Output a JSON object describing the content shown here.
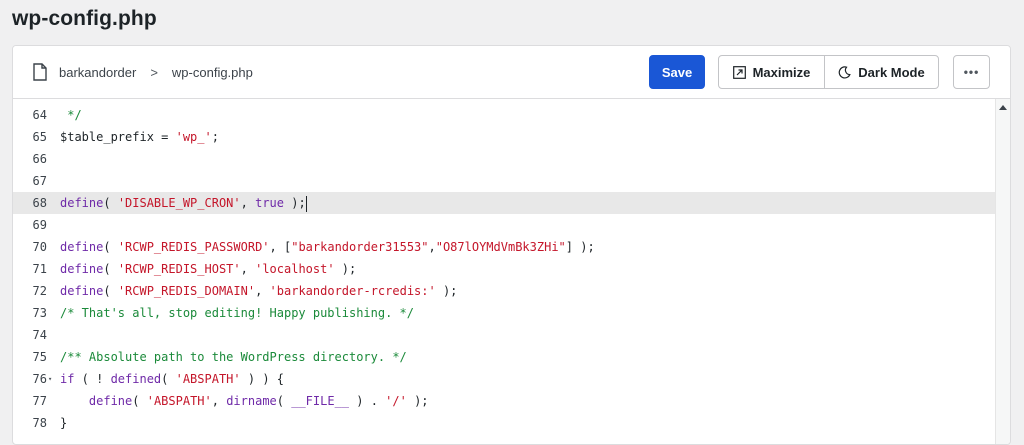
{
  "page": {
    "title": "wp-config.php"
  },
  "breadcrumb": {
    "root": "barkandorder",
    "separator": ">",
    "file": "wp-config.php"
  },
  "toolbar": {
    "save_label": "Save",
    "maximize_label": "Maximize",
    "dark_mode_label": "Dark Mode",
    "more_label": "•••"
  },
  "colors": {
    "accent": "#1a57d6",
    "comment": "#1b8a3a",
    "function": "#6f2aa8",
    "string": "#c4162a"
  },
  "editor": {
    "active_line": 68,
    "lines": [
      {
        "n": "64",
        "tokens": [
          {
            "t": "comment",
            "v": " */"
          }
        ]
      },
      {
        "n": "65",
        "tokens": [
          {
            "t": "var",
            "v": "$table_prefix"
          },
          {
            "t": "op",
            "v": " = "
          },
          {
            "t": "str",
            "v": "'wp_'"
          },
          {
            "t": "op",
            "v": ";"
          }
        ]
      },
      {
        "n": "66",
        "tokens": []
      },
      {
        "n": "67",
        "tokens": []
      },
      {
        "n": "68",
        "tokens": [
          {
            "t": "fn",
            "v": "define"
          },
          {
            "t": "op",
            "v": "( "
          },
          {
            "t": "str",
            "v": "'DISABLE_WP_CRON'"
          },
          {
            "t": "op",
            "v": ", "
          },
          {
            "t": "kw",
            "v": "true"
          },
          {
            "t": "op",
            "v": " );"
          }
        ]
      },
      {
        "n": "69",
        "tokens": []
      },
      {
        "n": "70",
        "tokens": [
          {
            "t": "fn",
            "v": "define"
          },
          {
            "t": "op",
            "v": "( "
          },
          {
            "t": "str",
            "v": "'RCWP_REDIS_PASSWORD'"
          },
          {
            "t": "op",
            "v": ", ["
          },
          {
            "t": "str",
            "v": "\"barkandorder31553\""
          },
          {
            "t": "op",
            "v": ","
          },
          {
            "t": "str",
            "v": "\"O87lOYMdVmBk3ZHi\""
          },
          {
            "t": "op",
            "v": "] );"
          }
        ]
      },
      {
        "n": "71",
        "tokens": [
          {
            "t": "fn",
            "v": "define"
          },
          {
            "t": "op",
            "v": "( "
          },
          {
            "t": "str",
            "v": "'RCWP_REDIS_HOST'"
          },
          {
            "t": "op",
            "v": ", "
          },
          {
            "t": "str",
            "v": "'localhost'"
          },
          {
            "t": "op",
            "v": " );"
          }
        ]
      },
      {
        "n": "72",
        "tokens": [
          {
            "t": "fn",
            "v": "define"
          },
          {
            "t": "op",
            "v": "( "
          },
          {
            "t": "str",
            "v": "'RCWP_REDIS_DOMAIN'"
          },
          {
            "t": "op",
            "v": ", "
          },
          {
            "t": "str",
            "v": "'barkandorder-rcredis:'"
          },
          {
            "t": "op",
            "v": " );"
          }
        ]
      },
      {
        "n": "73",
        "tokens": [
          {
            "t": "comment",
            "v": "/* That's all, stop editing! Happy publishing. */"
          }
        ]
      },
      {
        "n": "74",
        "tokens": []
      },
      {
        "n": "75",
        "tokens": [
          {
            "t": "comment",
            "v": "/** Absolute path to the WordPress directory. */"
          }
        ]
      },
      {
        "n": "76",
        "fold": true,
        "tokens": [
          {
            "t": "kw",
            "v": "if"
          },
          {
            "t": "op",
            "v": " ( ! "
          },
          {
            "t": "fn",
            "v": "defined"
          },
          {
            "t": "op",
            "v": "( "
          },
          {
            "t": "str",
            "v": "'ABSPATH'"
          },
          {
            "t": "op",
            "v": " ) ) {"
          }
        ]
      },
      {
        "n": "77",
        "tokens": [
          {
            "t": "op",
            "v": "    "
          },
          {
            "t": "fn",
            "v": "define"
          },
          {
            "t": "op",
            "v": "( "
          },
          {
            "t": "str",
            "v": "'ABSPATH'"
          },
          {
            "t": "op",
            "v": ", "
          },
          {
            "t": "fn",
            "v": "dirname"
          },
          {
            "t": "op",
            "v": "( "
          },
          {
            "t": "fn",
            "v": "__FILE__"
          },
          {
            "t": "op",
            "v": " ) . "
          },
          {
            "t": "str",
            "v": "'/'"
          },
          {
            "t": "op",
            "v": " );"
          }
        ]
      },
      {
        "n": "78",
        "tokens": [
          {
            "t": "op",
            "v": "}"
          }
        ]
      }
    ]
  }
}
